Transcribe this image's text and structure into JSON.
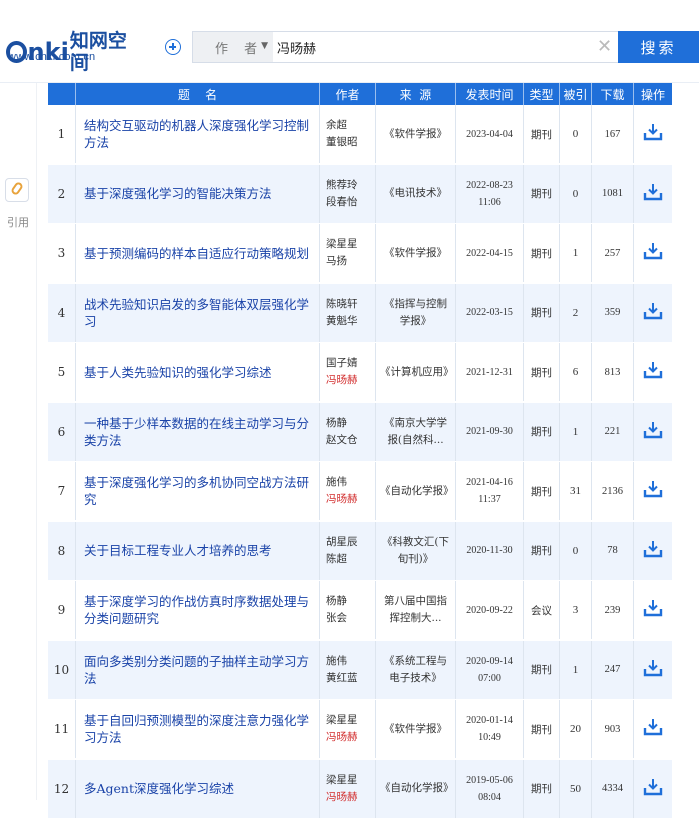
{
  "brand": {
    "logo_cn": "知网空间",
    "logo_url": "www.cnki.com.cn"
  },
  "search": {
    "field": "作 者",
    "query": "冯旸赫",
    "button": "搜索"
  },
  "sidebar": {
    "cite_label": "引用"
  },
  "colors": {
    "accent": "#1f6fd9",
    "link": "#1a43a8",
    "highlight": "#d22d2d",
    "row_alt": "#eef4fd"
  },
  "table": {
    "headers": [
      "",
      "题    名",
      "作者",
      "来  源",
      "发表时间",
      "类型",
      "被引",
      "下载",
      "操作"
    ],
    "rows": [
      {
        "num": "1",
        "title": "结构交互驱动的机器人深度强化学习控制方法",
        "authors": [
          "余超",
          "董银昭"
        ],
        "source": "《软件学报》",
        "date": [
          "2023-04-04"
        ],
        "type": "期刊",
        "cited": "0",
        "downloads": "167"
      },
      {
        "num": "2",
        "title": "基于深度强化学习的智能决策方法",
        "authors": [
          "熊荐玲",
          "段春怡"
        ],
        "source": "《电讯技术》",
        "date": [
          "2022-08-23",
          "11:06"
        ],
        "type": "期刊",
        "cited": "0",
        "downloads": "1081"
      },
      {
        "num": "3",
        "title": "基于预测编码的样本自适应行动策略规划",
        "authors": [
          "梁星星",
          "马扬"
        ],
        "source": "《软件学报》",
        "date": [
          "2022-04-15"
        ],
        "type": "期刊",
        "cited": "1",
        "downloads": "257"
      },
      {
        "num": "4",
        "title": "战术先验知识启发的多智能体双层强化学习",
        "authors": [
          "陈晓轩",
          "黄魁华"
        ],
        "source": "《指挥与控制学报》",
        "date": [
          "2022-03-15"
        ],
        "type": "期刊",
        "cited": "2",
        "downloads": "359"
      },
      {
        "num": "5",
        "title": "基于人类先验知识的强化学习综述",
        "authors": [
          "国子婧",
          "冯旸赫"
        ],
        "source": "《计算机应用》",
        "date": [
          "2021-12-31"
        ],
        "type": "期刊",
        "cited": "6",
        "downloads": "813"
      },
      {
        "num": "6",
        "title": "一种基于少样本数据的在线主动学习与分类方法",
        "authors": [
          "杨静",
          "赵文仓"
        ],
        "source": "《南京大学学报(自然科...",
        "date": [
          "2021-09-30"
        ],
        "type": "期刊",
        "cited": "1",
        "downloads": "221"
      },
      {
        "num": "7",
        "title": "基于深度强化学习的多机协同空战方法研究",
        "authors": [
          "施伟",
          "冯旸赫"
        ],
        "source": "《自动化学报》",
        "date": [
          "2021-04-16",
          "11:37"
        ],
        "type": "期刊",
        "cited": "31",
        "downloads": "2136"
      },
      {
        "num": "8",
        "title": "关于目标工程专业人才培养的思考",
        "authors": [
          "胡星辰",
          "陈超"
        ],
        "source": "《科教文汇(下旬刊)》",
        "date": [
          "2020-11-30"
        ],
        "type": "期刊",
        "cited": "0",
        "downloads": "78"
      },
      {
        "num": "9",
        "title": "基于深度学习的作战仿真时序数据处理与分类问题研究",
        "authors": [
          "杨静",
          "张会"
        ],
        "source": "第八届中国指挥控制大...",
        "date": [
          "2020-09-22"
        ],
        "type": "会议",
        "cited": "3",
        "downloads": "239"
      },
      {
        "num": "10",
        "title": "面向多类别分类问题的子抽样主动学习方法",
        "authors": [
          "施伟",
          "黄红蓝"
        ],
        "source": "《系统工程与电子技术》",
        "date": [
          "2020-09-14",
          "07:00"
        ],
        "type": "期刊",
        "cited": "1",
        "downloads": "247"
      },
      {
        "num": "11",
        "title": "基于自回归预测模型的深度注意力强化学习方法",
        "authors": [
          "梁星星",
          "冯旸赫"
        ],
        "source": "《软件学报》",
        "date": [
          "2020-01-14",
          "10:49"
        ],
        "type": "期刊",
        "cited": "20",
        "downloads": "903"
      },
      {
        "num": "12",
        "title": "多Agent深度强化学习综述",
        "authors": [
          "梁星星",
          "冯旸赫"
        ],
        "source": "《自动化学报》",
        "date": [
          "2019-05-06",
          "08:04"
        ],
        "type": "期刊",
        "cited": "50",
        "downloads": "4334"
      }
    ]
  }
}
